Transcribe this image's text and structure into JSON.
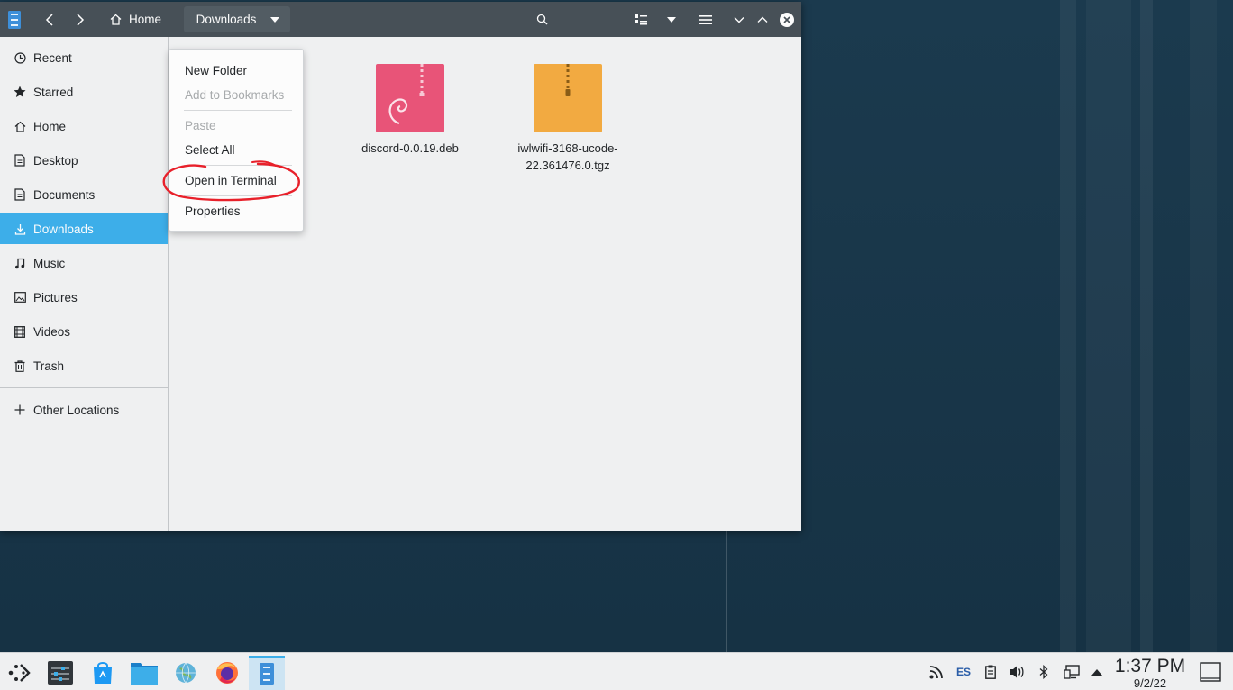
{
  "window": {
    "breadcrumb": {
      "home": "Home",
      "current": "Downloads"
    }
  },
  "sidebar": {
    "items": [
      {
        "label": "Recent",
        "icon": "clock-icon"
      },
      {
        "label": "Starred",
        "icon": "star-icon"
      },
      {
        "label": "Home",
        "icon": "home-icon"
      },
      {
        "label": "Desktop",
        "icon": "desktop-icon"
      },
      {
        "label": "Documents",
        "icon": "document-icon"
      },
      {
        "label": "Downloads",
        "icon": "download-icon",
        "active": true
      },
      {
        "label": "Music",
        "icon": "music-icon"
      },
      {
        "label": "Pictures",
        "icon": "picture-icon"
      },
      {
        "label": "Videos",
        "icon": "video-icon"
      },
      {
        "label": "Trash",
        "icon": "trash-icon"
      }
    ],
    "other_locations": "Other Locations"
  },
  "context_menu": {
    "items": [
      {
        "label": "New Folder",
        "enabled": true
      },
      {
        "label": "Add to Bookmarks",
        "enabled": false
      },
      {
        "label": "Paste",
        "enabled": false
      },
      {
        "label": "Select All",
        "enabled": true
      },
      {
        "label": "Open in Terminal",
        "enabled": true,
        "highlighted": true
      },
      {
        "label": "Properties",
        "enabled": true
      }
    ]
  },
  "files": [
    {
      "name": "discord-0.0.19.deb",
      "icon": "deb-package-icon",
      "color": "#e85478"
    },
    {
      "name_line1": "iwlwifi-3168-ucode-",
      "name_line2": "22.361476.0.tgz",
      "icon": "archive-icon",
      "color": "#f2aa41"
    }
  ],
  "taskbar": {
    "language": "ES",
    "time": "1:37 PM",
    "date": "9/2/22"
  },
  "colors": {
    "titlebar": "#475057",
    "accent": "#3daee9",
    "annotation": "#e8202a"
  }
}
